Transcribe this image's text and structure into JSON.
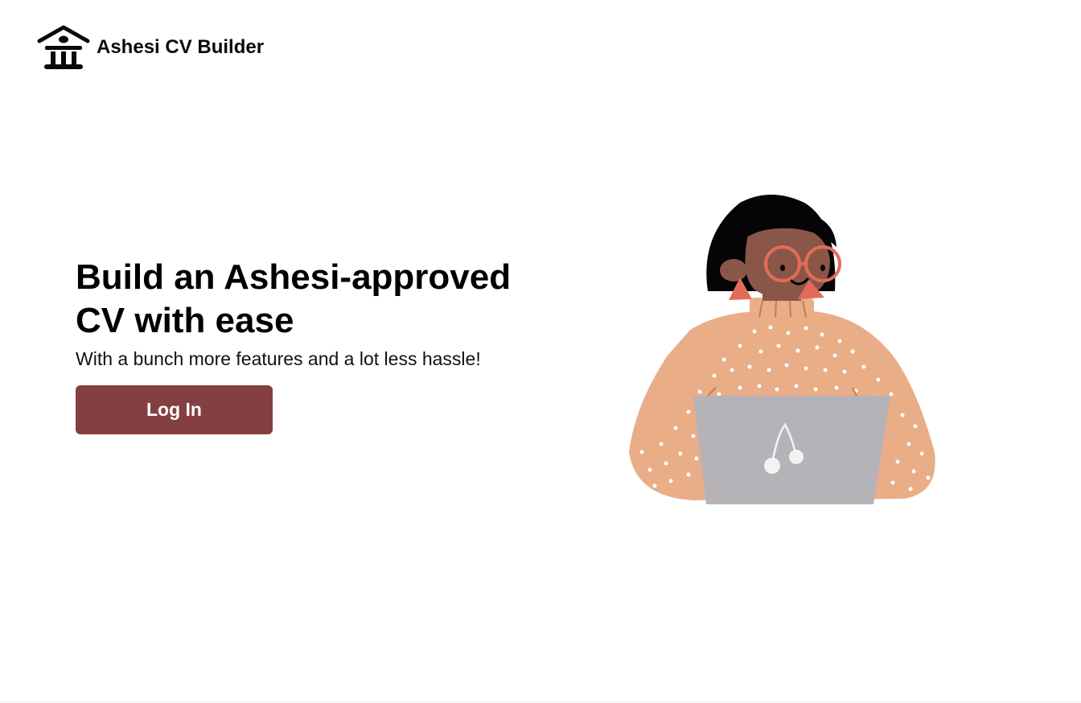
{
  "header": {
    "logo_icon": "school-building-icon",
    "brand_name": "Ashesi CV Builder"
  },
  "hero": {
    "headline_line1": "Build an Ashesi-approved",
    "headline_line2": "CV with ease",
    "subheadline": "With a bunch more features and a lot less hassle!",
    "login_label": "Log In",
    "illustration_icon": "woman-with-laptop-illustration"
  },
  "colors": {
    "primary_button": "#843f40",
    "background": "#ffffff",
    "sweater": "#e9ad88",
    "skin": "#8a5648",
    "glasses": "#e46b58",
    "laptop": "#b6b3b8"
  }
}
